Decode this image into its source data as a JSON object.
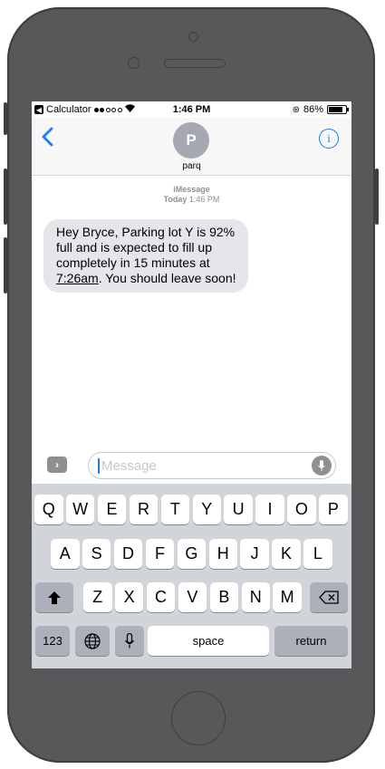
{
  "status_bar": {
    "app_back_label": "Calculator",
    "wifi_icon": "wifi-icon",
    "time": "1:46 PM",
    "battery": "86%",
    "battery_level": 0.86
  },
  "conversation": {
    "avatar_initial": "P",
    "contact_name": "parq"
  },
  "thread": {
    "service": "iMessage",
    "date_label": "Today",
    "date_time": "1:46 PM",
    "message_before_link": "Hey Bryce, Parking lot Y is 92% full and is expected to fill up completely in 15 minutes at ",
    "message_link": "7:26am",
    "message_after_link": ". You should leave soon!"
  },
  "input": {
    "placeholder": "Message"
  },
  "keyboard": {
    "row1": [
      "Q",
      "W",
      "E",
      "R",
      "T",
      "Y",
      "U",
      "I",
      "O",
      "P"
    ],
    "row2": [
      "A",
      "S",
      "D",
      "F",
      "G",
      "H",
      "J",
      "K",
      "L"
    ],
    "row3": [
      "Z",
      "X",
      "C",
      "V",
      "B",
      "N",
      "M"
    ],
    "numbers_label": "123",
    "space_label": "space",
    "return_label": "return"
  },
  "colors": {
    "accent": "#147efb",
    "bubble_gray": "#e5e5ea",
    "phone_body": "#58585a",
    "keyboard_bg": "#d1d4d9"
  }
}
